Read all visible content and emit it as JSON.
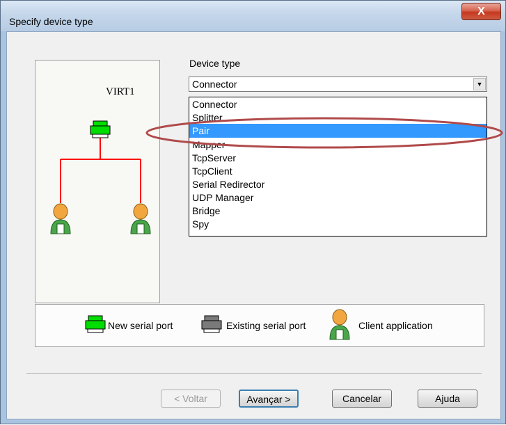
{
  "window": {
    "title": "Specify device type",
    "close_label": "X"
  },
  "diagram": {
    "device_name": "VIRT1",
    "connector_color": "#ff0000",
    "new_port_color": "#00dd00"
  },
  "device_type": {
    "label": "Device type",
    "selected_value": "Connector",
    "options": [
      {
        "label": "Connector",
        "highlighted": false
      },
      {
        "label": "Splitter",
        "highlighted": false
      },
      {
        "label": "Pair",
        "highlighted": true
      },
      {
        "label": "Mapper",
        "highlighted": false
      },
      {
        "label": "TcpServer",
        "highlighted": false
      },
      {
        "label": "TcpClient",
        "highlighted": false
      },
      {
        "label": "Serial Redirector",
        "highlighted": false
      },
      {
        "label": "UDP Manager",
        "highlighted": false
      },
      {
        "label": "Bridge",
        "highlighted": false
      },
      {
        "label": "Spy",
        "highlighted": false
      }
    ],
    "highlight_color": "#3399ff",
    "annotation_color": "#b04a4a"
  },
  "legend": {
    "new_port": "New serial port",
    "existing_port": "Existing serial port",
    "client_app": "Client application"
  },
  "buttons": {
    "back": "< Voltar",
    "next": "Avançar >",
    "cancel": "Cancelar",
    "help": "Ajuda"
  }
}
